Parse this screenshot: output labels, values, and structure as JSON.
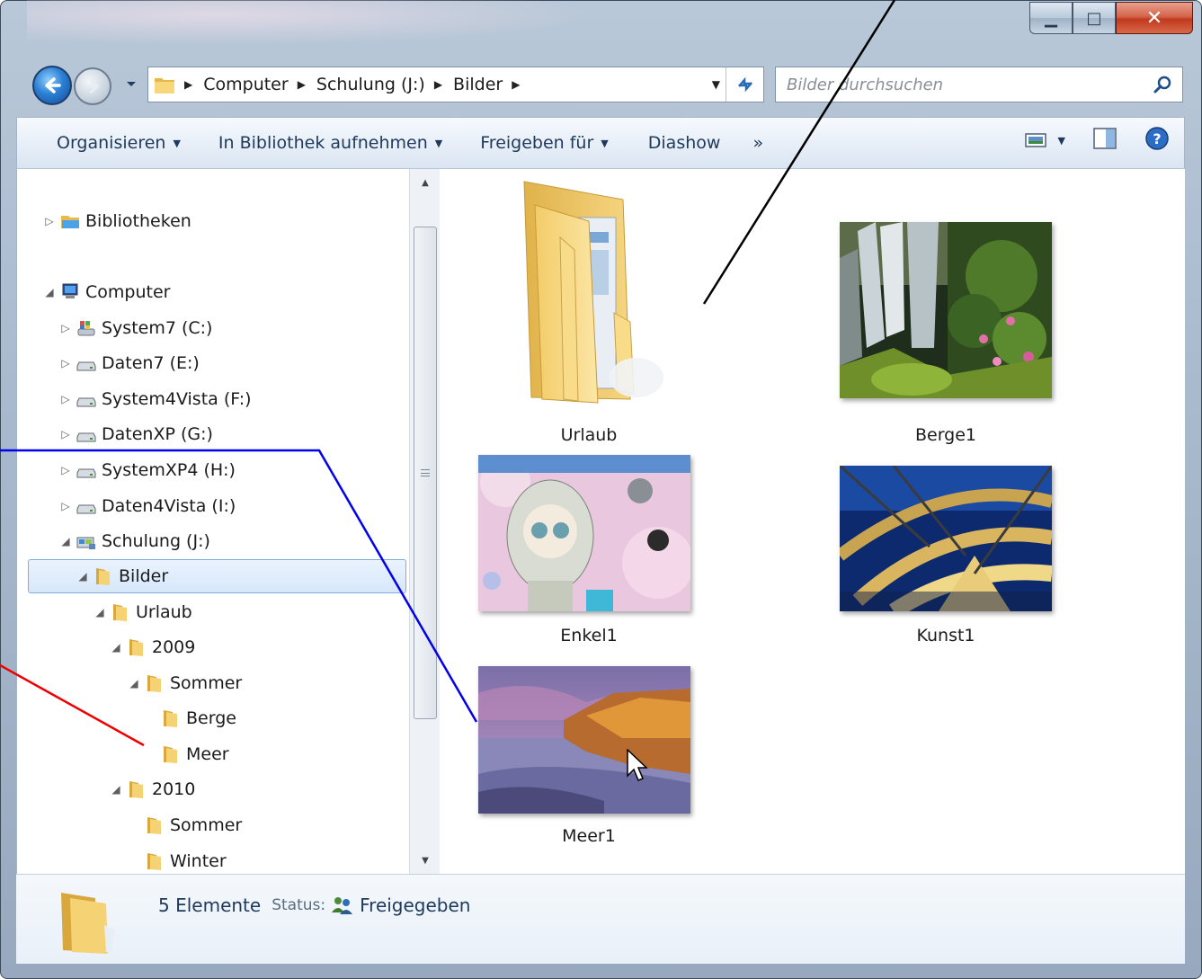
{
  "address": {
    "crumbs": [
      "Computer",
      "Schulung (J:)",
      "Bilder"
    ]
  },
  "search": {
    "placeholder": "Bilder durchsuchen"
  },
  "toolbar": {
    "organize": "Organisieren",
    "add_library": "In Bibliothek aufnehmen",
    "share": "Freigeben für",
    "slideshow": "Diashow",
    "more": "»"
  },
  "tree": {
    "libraries": "Bibliotheken",
    "computer": "Computer",
    "drives": [
      "System7 (C:)",
      "Daten7 (E:)",
      "System4Vista (F:)",
      "DatenXP (G:)",
      "SystemXP4 (H:)",
      "Daten4Vista (I:)",
      "Schulung (J:)"
    ],
    "folders": [
      "Bilder",
      "Urlaub",
      "2009",
      "Sommer",
      "Berge",
      "Meer",
      "2010",
      "Sommer",
      "Winter"
    ]
  },
  "items": [
    "Urlaub",
    "Berge1",
    "Enkel1",
    "Kunst1",
    "Meer1"
  ],
  "details": {
    "count": "5 Elemente",
    "status_label": "Status:",
    "status_value": "Freigegeben"
  },
  "colors": {
    "annotation_black": "#000000",
    "annotation_blue": "#0000ee",
    "annotation_red": "#ee0000",
    "folder_yellow": "#f1cf6a"
  }
}
